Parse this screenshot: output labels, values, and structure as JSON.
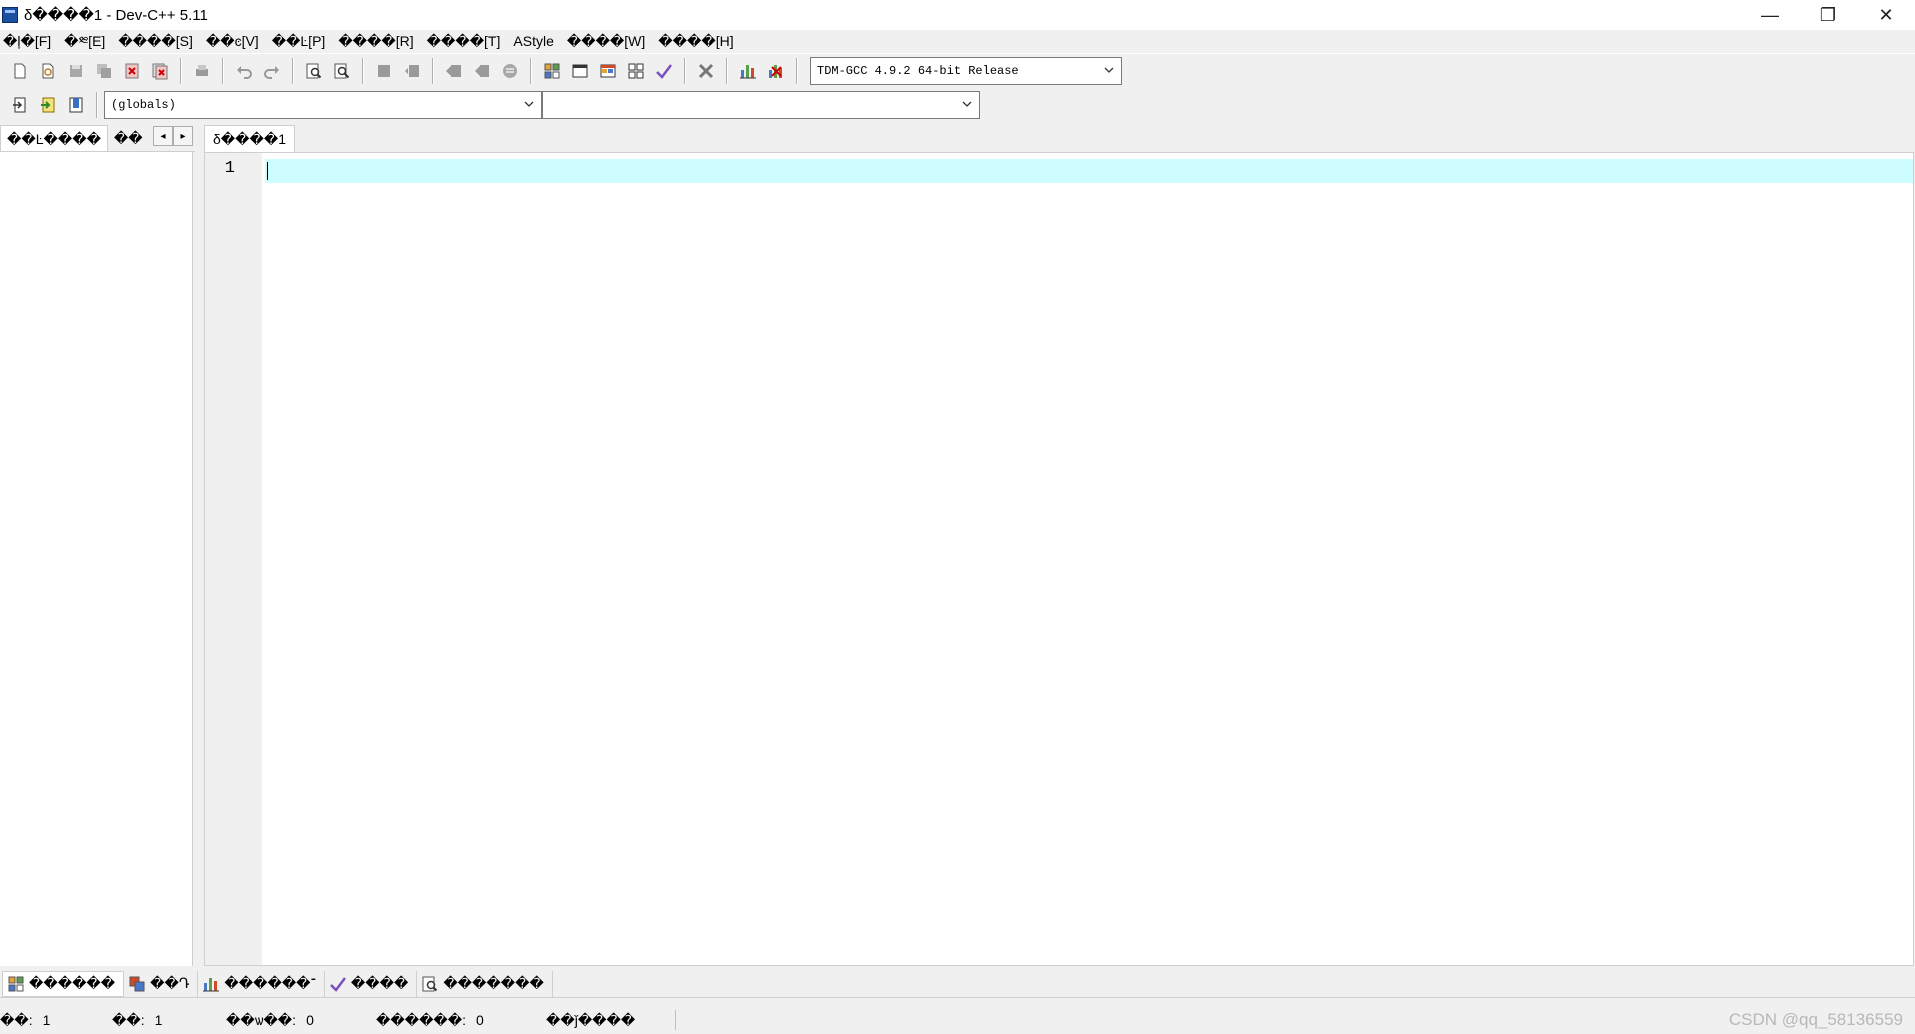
{
  "window": {
    "title": "δ����1 - Dev-C++ 5.11",
    "minimize": "—",
    "maximize": "❐",
    "close": "✕"
  },
  "menu": [
    "�ļ�[F]",
    "�༭[E]",
    "����[S]",
    "��ͼ[V]",
    "��Ŀ[P]",
    "����[R]",
    "����[T]",
    "AStyle",
    "����[W]",
    "����[H]"
  ],
  "toolbar": {
    "compiler": "TDM-GCC 4.9.2 64-bit Release"
  },
  "toolbar2": {
    "scope": "(globals)",
    "member": ""
  },
  "left_panel": {
    "tabs": [
      "��Ŀ����",
      "��"
    ],
    "prev_arrow": "◂",
    "next_arrow": "▸"
  },
  "editor": {
    "tab": "δ����1",
    "line_number": "1"
  },
  "bottom_tabs": [
    "������",
    "��Դ",
    "������־",
    "����",
    "�������"
  ],
  "status": {
    "row_label": "��:",
    "row_value": "1",
    "col_label": "��:",
    "col_value": "1",
    "sel_label": "��ѡ��:",
    "sel_value": "0",
    "lines_label": "������:",
    "lines_value": "0",
    "mode": "��ǰ����"
  },
  "watermark": "CSDN @qq_58136559",
  "colors": {
    "current_line": "#cdfdff",
    "gutter": "#f0f0f0",
    "chrome": "#f0f0f0"
  }
}
